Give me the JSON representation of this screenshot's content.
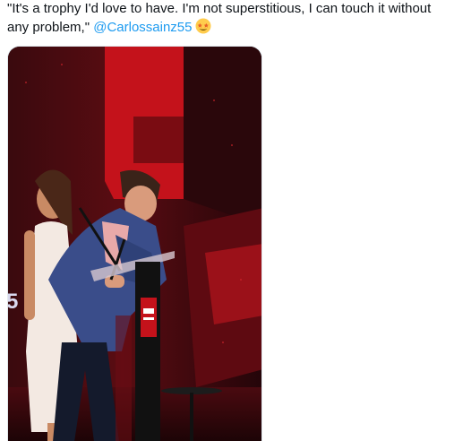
{
  "tweet": {
    "text_before": "\"It's a trophy I'd love to have. I'm not superstitious, I can touch it without any problem,\" ",
    "mention": "@Carlossainz55",
    "emoji": "star-struck-emoji"
  },
  "media": {
    "kind": "photo",
    "scene": "stage-award-photo",
    "stage_sign_text": "5",
    "colors": {
      "stage_red": "#c4121b",
      "backdrop": "#2a070b",
      "mention": "#1d9bf0"
    }
  }
}
